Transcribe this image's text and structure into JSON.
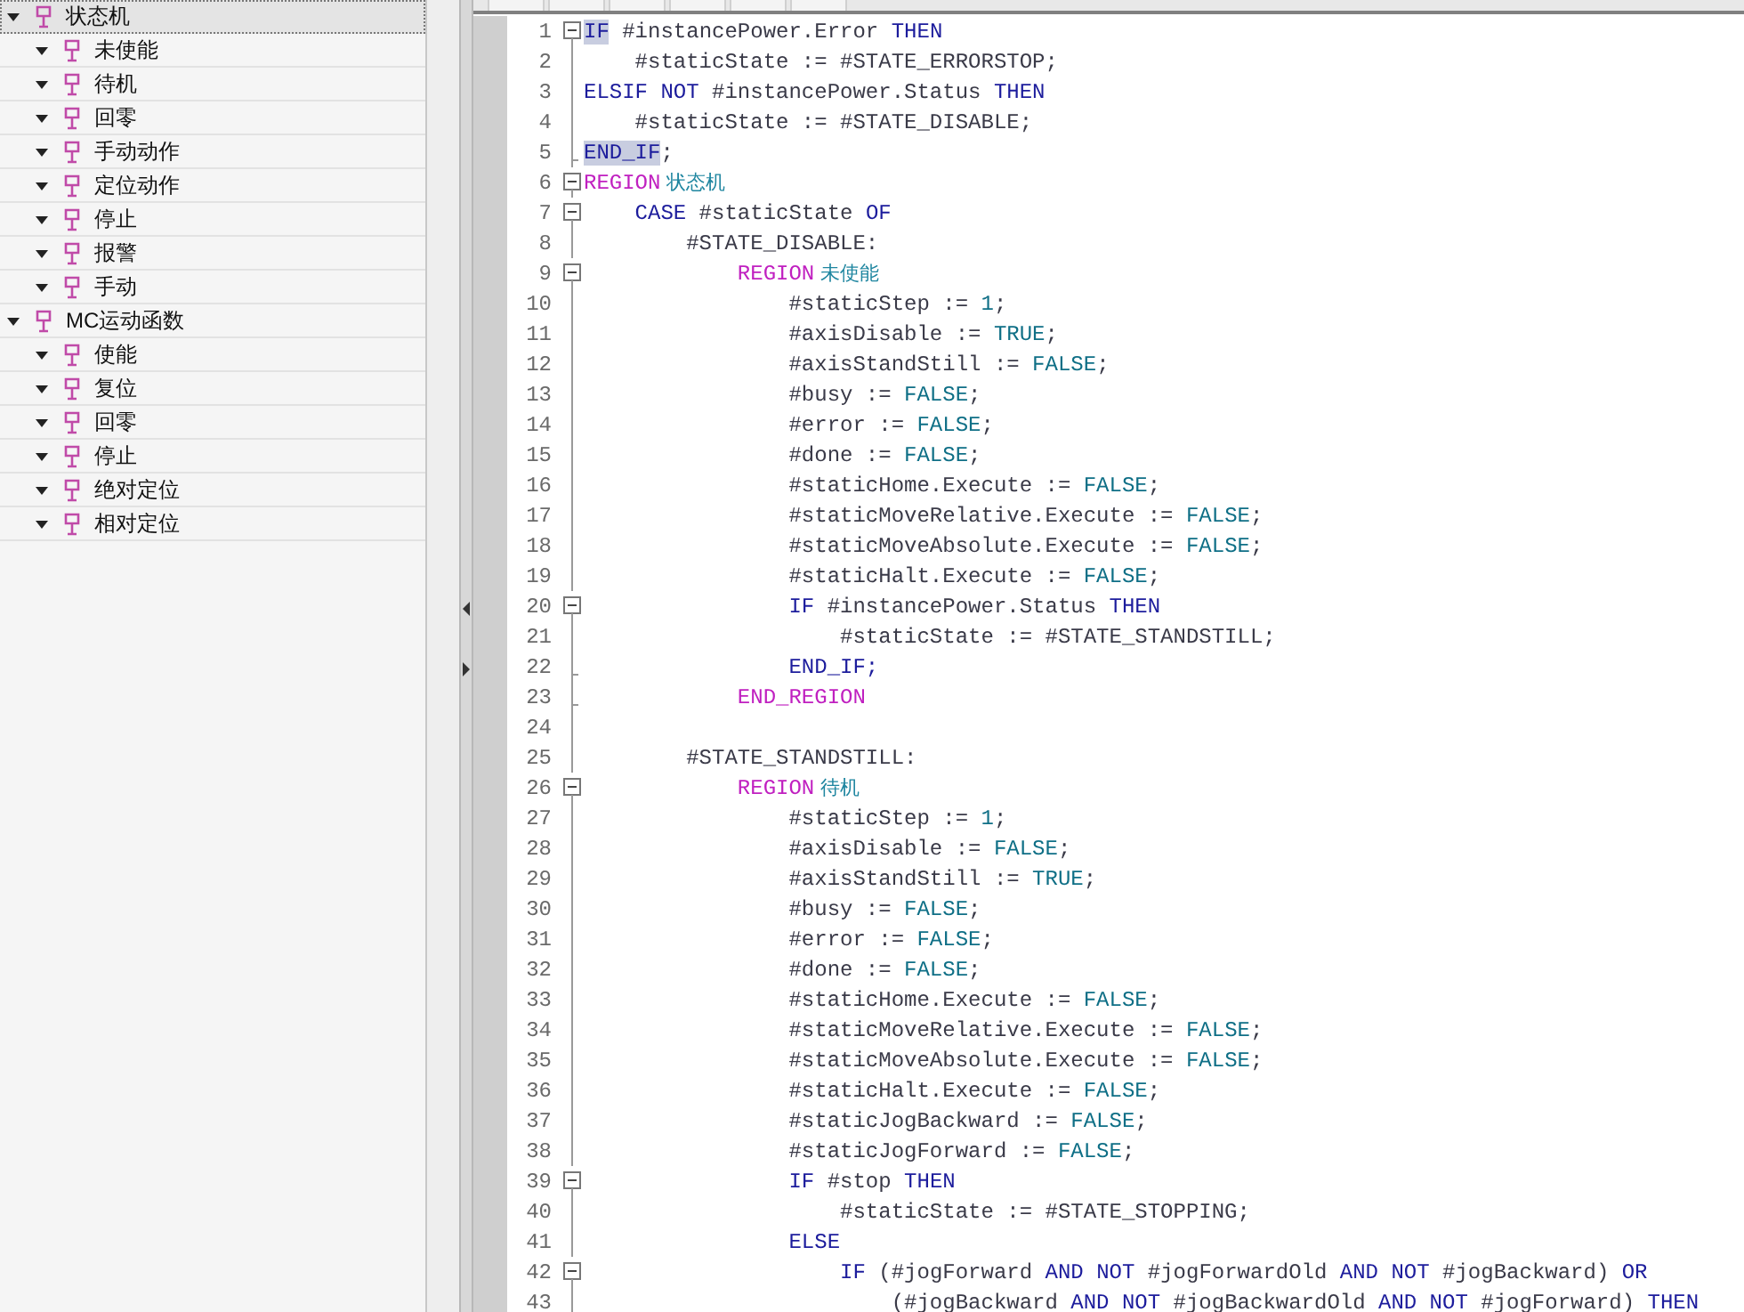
{
  "tree": [
    {
      "label": "状态机",
      "expanded": true,
      "selected": true,
      "children": [
        {
          "label": "未使能",
          "expanded": true,
          "selected": false
        },
        {
          "label": "待机",
          "expanded": true,
          "selected": false
        },
        {
          "label": "回零",
          "expanded": true,
          "selected": false
        },
        {
          "label": "手动动作",
          "expanded": true,
          "selected": false
        },
        {
          "label": "定位动作",
          "expanded": true,
          "selected": false
        },
        {
          "label": "停止",
          "expanded": true,
          "selected": false
        },
        {
          "label": "报警",
          "expanded": true,
          "selected": false
        },
        {
          "label": "手动",
          "expanded": true,
          "selected": false
        }
      ]
    },
    {
      "label": "MC运动函数",
      "expanded": true,
      "selected": false,
      "children": [
        {
          "label": "使能",
          "expanded": true,
          "selected": false
        },
        {
          "label": "复位",
          "expanded": true,
          "selected": false
        },
        {
          "label": "回零",
          "expanded": true,
          "selected": false
        },
        {
          "label": "停止",
          "expanded": true,
          "selected": false
        },
        {
          "label": "绝对定位",
          "expanded": true,
          "selected": false
        },
        {
          "label": "相对定位",
          "expanded": true,
          "selected": false
        }
      ]
    }
  ],
  "code_lines": [
    {
      "number": "1",
      "kind": "start",
      "tokens": [
        {
          "text": "IF",
          "kind": "matched"
        },
        {
          "text": " #instancePower.Error ",
          "kind": "plain"
        },
        {
          "text": "THEN",
          "kind": "keyword"
        }
      ]
    },
    {
      "number": "2",
      "kind": "line",
      "tokens": [
        {
          "text": "    #staticState := #STATE_ERRORSTOP;",
          "kind": "plain"
        }
      ]
    },
    {
      "number": "3",
      "kind": "line",
      "tokens": [
        {
          "text": "ELSIF NOT",
          "kind": "keyword"
        },
        {
          "text": " #instancePower.Status ",
          "kind": "plain"
        },
        {
          "text": "THEN",
          "kind": "keyword"
        }
      ]
    },
    {
      "number": "4",
      "kind": "line",
      "tokens": [
        {
          "text": "    #staticState := #STATE_DISABLE;",
          "kind": "plain"
        }
      ]
    },
    {
      "number": "5",
      "kind": "end",
      "tokens": [
        {
          "text": "END_IF",
          "kind": "matched"
        },
        {
          "text": ";",
          "kind": "plain"
        }
      ]
    },
    {
      "number": "6",
      "kind": "start",
      "tokens": [
        {
          "text": "REGION",
          "kind": "region"
        },
        {
          "text": " 状态机",
          "kind": "name"
        }
      ]
    },
    {
      "number": "7",
      "kind": "start",
      "tokens": [
        {
          "text": "    CASE",
          "kind": "keyword"
        },
        {
          "text": " #staticState ",
          "kind": "plain"
        },
        {
          "text": "OF",
          "kind": "keyword"
        }
      ]
    },
    {
      "number": "8",
      "kind": "line",
      "tokens": [
        {
          "text": "        #STATE_DISABLE:",
          "kind": "plain"
        }
      ]
    },
    {
      "number": "9",
      "kind": "start",
      "tokens": [
        {
          "text": "            REGION",
          "kind": "region"
        },
        {
          "text": " 未使能",
          "kind": "name"
        }
      ]
    },
    {
      "number": "10",
      "kind": "line",
      "tokens": [
        {
          "text": "                #staticStep := ",
          "kind": "plain"
        },
        {
          "text": "1",
          "kind": "constant"
        },
        {
          "text": ";",
          "kind": "plain"
        }
      ]
    },
    {
      "number": "11",
      "kind": "line",
      "tokens": [
        {
          "text": "                #axisDisable := ",
          "kind": "plain"
        },
        {
          "text": "TRUE",
          "kind": "constant"
        },
        {
          "text": ";",
          "kind": "plain"
        }
      ]
    },
    {
      "number": "12",
      "kind": "line",
      "tokens": [
        {
          "text": "                #axisStandStill := ",
          "kind": "plain"
        },
        {
          "text": "FALSE",
          "kind": "constant"
        },
        {
          "text": ";",
          "kind": "plain"
        }
      ]
    },
    {
      "number": "13",
      "kind": "line",
      "tokens": [
        {
          "text": "                #busy := ",
          "kind": "plain"
        },
        {
          "text": "FALSE",
          "kind": "constant"
        },
        {
          "text": ";",
          "kind": "plain"
        }
      ]
    },
    {
      "number": "14",
      "kind": "line",
      "tokens": [
        {
          "text": "                #error := ",
          "kind": "plain"
        },
        {
          "text": "FALSE",
          "kind": "constant"
        },
        {
          "text": ";",
          "kind": "plain"
        }
      ]
    },
    {
      "number": "15",
      "kind": "line",
      "tokens": [
        {
          "text": "                #done := ",
          "kind": "plain"
        },
        {
          "text": "FALSE",
          "kind": "constant"
        },
        {
          "text": ";",
          "kind": "plain"
        }
      ]
    },
    {
      "number": "16",
      "kind": "line",
      "tokens": [
        {
          "text": "                #staticHome.Execute := ",
          "kind": "plain"
        },
        {
          "text": "FALSE",
          "kind": "constant"
        },
        {
          "text": ";",
          "kind": "plain"
        }
      ]
    },
    {
      "number": "17",
      "kind": "line",
      "tokens": [
        {
          "text": "                #staticMoveRelative.Execute := ",
          "kind": "plain"
        },
        {
          "text": "FALSE",
          "kind": "constant"
        },
        {
          "text": ";",
          "kind": "plain"
        }
      ]
    },
    {
      "number": "18",
      "kind": "line",
      "tokens": [
        {
          "text": "                #staticMoveAbsolute.Execute := ",
          "kind": "plain"
        },
        {
          "text": "FALSE",
          "kind": "constant"
        },
        {
          "text": ";",
          "kind": "plain"
        }
      ]
    },
    {
      "number": "19",
      "kind": "line",
      "tokens": [
        {
          "text": "                #staticHalt.Execute := ",
          "kind": "plain"
        },
        {
          "text": "FALSE",
          "kind": "constant"
        },
        {
          "text": ";",
          "kind": "plain"
        }
      ]
    },
    {
      "number": "20",
      "kind": "start",
      "tokens": [
        {
          "text": "                IF",
          "kind": "keyword"
        },
        {
          "text": " #instancePower.Status ",
          "kind": "plain"
        },
        {
          "text": "THEN",
          "kind": "keyword"
        }
      ]
    },
    {
      "number": "21",
      "kind": "line",
      "tokens": [
        {
          "text": "                    #staticState := #STATE_STANDSTILL;",
          "kind": "plain"
        }
      ]
    },
    {
      "number": "22",
      "kind": "end",
      "tokens": [
        {
          "text": "                END_IF;",
          "kind": "keyword"
        }
      ]
    },
    {
      "number": "23",
      "kind": "end",
      "tokens": [
        {
          "text": "            END_REGION",
          "kind": "region"
        }
      ]
    },
    {
      "number": "24",
      "kind": "line"
    },
    {
      "number": "25",
      "kind": "line",
      "tokens": [
        {
          "text": "        #STATE_STANDSTILL:",
          "kind": "plain"
        }
      ]
    },
    {
      "number": "26",
      "kind": "start",
      "tokens": [
        {
          "text": "            REGION",
          "kind": "region"
        },
        {
          "text": " 待机",
          "kind": "name"
        }
      ]
    },
    {
      "number": "27",
      "kind": "line",
      "tokens": [
        {
          "text": "                #staticStep := ",
          "kind": "plain"
        },
        {
          "text": "1",
          "kind": "constant"
        },
        {
          "text": ";",
          "kind": "plain"
        }
      ]
    },
    {
      "number": "28",
      "kind": "line",
      "tokens": [
        {
          "text": "                #axisDisable := ",
          "kind": "plain"
        },
        {
          "text": "FALSE",
          "kind": "constant"
        },
        {
          "text": ";",
          "kind": "plain"
        }
      ]
    },
    {
      "number": "29",
      "kind": "line",
      "tokens": [
        {
          "text": "                #axisStandStill := ",
          "kind": "plain"
        },
        {
          "text": "TRUE",
          "kind": "constant"
        },
        {
          "text": ";",
          "kind": "plain"
        }
      ]
    },
    {
      "number": "30",
      "kind": "line",
      "tokens": [
        {
          "text": "                #busy := ",
          "kind": "plain"
        },
        {
          "text": "FALSE",
          "kind": "constant"
        },
        {
          "text": ";",
          "kind": "plain"
        }
      ]
    },
    {
      "number": "31",
      "kind": "line",
      "tokens": [
        {
          "text": "                #error := ",
          "kind": "plain"
        },
        {
          "text": "FALSE",
          "kind": "constant"
        },
        {
          "text": ";",
          "kind": "plain"
        }
      ]
    },
    {
      "number": "32",
      "kind": "line",
      "tokens": [
        {
          "text": "                #done := ",
          "kind": "plain"
        },
        {
          "text": "FALSE",
          "kind": "constant"
        },
        {
          "text": ";",
          "kind": "plain"
        }
      ]
    },
    {
      "number": "33",
      "kind": "line",
      "tokens": [
        {
          "text": "                #staticHome.Execute := ",
          "kind": "plain"
        },
        {
          "text": "FALSE",
          "kind": "constant"
        },
        {
          "text": ";",
          "kind": "plain"
        }
      ]
    },
    {
      "number": "34",
      "kind": "line",
      "tokens": [
        {
          "text": "                #staticMoveRelative.Execute := ",
          "kind": "plain"
        },
        {
          "text": "FALSE",
          "kind": "constant"
        },
        {
          "text": ";",
          "kind": "plain"
        }
      ]
    },
    {
      "number": "35",
      "kind": "line",
      "tokens": [
        {
          "text": "                #staticMoveAbsolute.Execute := ",
          "kind": "plain"
        },
        {
          "text": "FALSE",
          "kind": "constant"
        },
        {
          "text": ";",
          "kind": "plain"
        }
      ]
    },
    {
      "number": "36",
      "kind": "line",
      "tokens": [
        {
          "text": "                #staticHalt.Execute := ",
          "kind": "plain"
        },
        {
          "text": "FALSE",
          "kind": "constant"
        },
        {
          "text": ";",
          "kind": "plain"
        }
      ]
    },
    {
      "number": "37",
      "kind": "line",
      "tokens": [
        {
          "text": "                #staticJogBackward := ",
          "kind": "plain"
        },
        {
          "text": "FALSE",
          "kind": "constant"
        },
        {
          "text": ";",
          "kind": "plain"
        }
      ]
    },
    {
      "number": "38",
      "kind": "line",
      "tokens": [
        {
          "text": "                #staticJogForward := ",
          "kind": "plain"
        },
        {
          "text": "FALSE",
          "kind": "constant"
        },
        {
          "text": ";",
          "kind": "plain"
        }
      ]
    },
    {
      "number": "39",
      "kind": "start",
      "tokens": [
        {
          "text": "                IF",
          "kind": "keyword"
        },
        {
          "text": " #stop ",
          "kind": "plain"
        },
        {
          "text": "THEN",
          "kind": "keyword"
        }
      ]
    },
    {
      "number": "40",
      "kind": "line",
      "tokens": [
        {
          "text": "                    #staticState := #STATE_STOPPING;",
          "kind": "plain"
        }
      ]
    },
    {
      "number": "41",
      "kind": "line",
      "tokens": [
        {
          "text": "                ELSE",
          "kind": "keyword"
        }
      ]
    },
    {
      "number": "42",
      "kind": "start",
      "tokens": [
        {
          "text": "                    IF",
          "kind": "keyword"
        },
        {
          "text": " (#jogForward ",
          "kind": "plain"
        },
        {
          "text": "AND NOT",
          "kind": "keyword"
        },
        {
          "text": " #jogForwardOld ",
          "kind": "plain"
        },
        {
          "text": "AND NOT",
          "kind": "keyword"
        },
        {
          "text": " #jogBackward) ",
          "kind": "plain"
        },
        {
          "text": "OR",
          "kind": "keyword"
        }
      ]
    },
    {
      "number": "43",
      "kind": "line",
      "tokens": [
        {
          "text": "                        (#jogBackward ",
          "kind": "plain"
        },
        {
          "text": "AND NOT",
          "kind": "keyword"
        },
        {
          "text": " #jogBackwardOld ",
          "kind": "plain"
        },
        {
          "text": "AND NOT",
          "kind": "keyword"
        },
        {
          "text": " #jogForward) ",
          "kind": "plain"
        },
        {
          "text": "THEN",
          "kind": "keyword"
        }
      ]
    }
  ]
}
